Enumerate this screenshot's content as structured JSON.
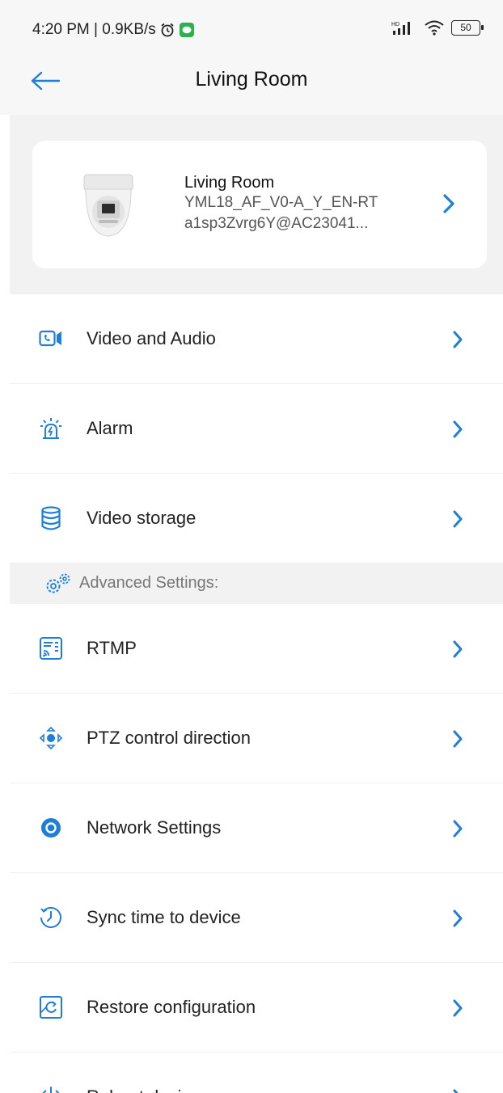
{
  "status_bar": {
    "time": "4:20 PM | 0.9KB/s",
    "battery": "50"
  },
  "header": {
    "title": "Living Room"
  },
  "device": {
    "name": "Living Room",
    "model": "YML18_AF_V0-A_Y_EN-RT",
    "id": "a1sp3Zvrg6Y@AC23041..."
  },
  "menu": {
    "items": [
      {
        "label": "Video and Audio",
        "icon": "video-audio-icon"
      },
      {
        "label": "Alarm",
        "icon": "alarm-icon"
      },
      {
        "label": "Video storage",
        "icon": "storage-icon"
      }
    ],
    "advanced_title": "Advanced Settings:",
    "advanced_items": [
      {
        "label": "RTMP",
        "icon": "rtmp-icon"
      },
      {
        "label": "PTZ control direction",
        "icon": "ptz-icon"
      },
      {
        "label": "Network Settings",
        "icon": "network-settings-icon"
      },
      {
        "label": "Sync time to device",
        "icon": "sync-time-icon"
      },
      {
        "label": "Restore configuration",
        "icon": "restore-icon"
      },
      {
        "label": "Reboot device",
        "icon": "reboot-icon"
      }
    ]
  },
  "colors": {
    "accent": "#1f7fd6",
    "background": "#f2f2f2",
    "card": "#ffffff"
  }
}
